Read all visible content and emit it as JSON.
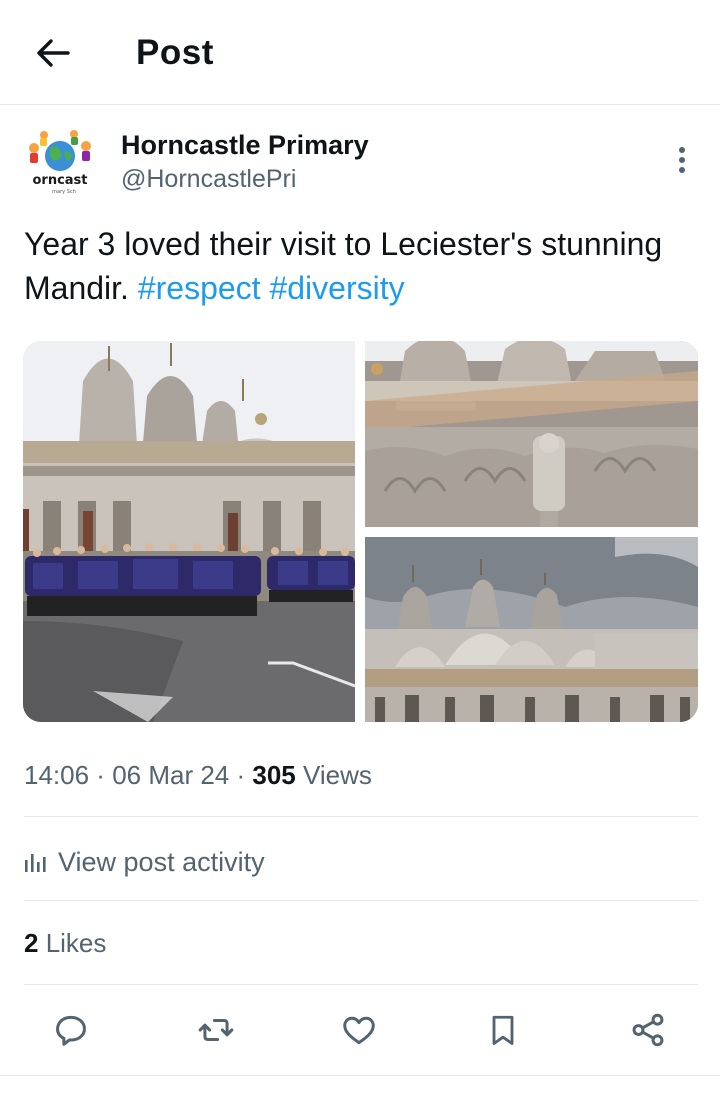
{
  "header": {
    "title": "Post",
    "back_icon": "arrow-left-icon"
  },
  "author": {
    "display_name": "Horncastle Primary",
    "handle": "@HorncastlePri",
    "avatar_text": "orncast",
    "avatar_subtext": "mary Sch"
  },
  "post": {
    "text": "Year 3 loved their visit to Leciester's stunning Mandir. ",
    "hashtags": [
      "#respect",
      "#diversity"
    ],
    "media": [
      {
        "name": "temple-group-photo",
        "description": "Pupils in front of temple"
      },
      {
        "name": "temple-carving-closeup",
        "description": "Temple carvings"
      },
      {
        "name": "temple-domes-photo",
        "description": "Temple domes"
      }
    ]
  },
  "meta": {
    "time": "14:06",
    "date": "06 Mar 24",
    "views_count": "305",
    "views_label": " Views"
  },
  "activity": {
    "label": "View post activity",
    "icon": "bar-chart-icon"
  },
  "likes": {
    "count": "2",
    "label": " Likes"
  },
  "actions": [
    {
      "name": "reply-icon"
    },
    {
      "name": "repost-icon"
    },
    {
      "name": "like-icon"
    },
    {
      "name": "bookmark-icon"
    },
    {
      "name": "share-icon"
    }
  ],
  "colors": {
    "accent": "#1d9bf0",
    "secondary_text": "#536471",
    "primary_text": "#0f1419",
    "divider": "#e6e8ea"
  }
}
